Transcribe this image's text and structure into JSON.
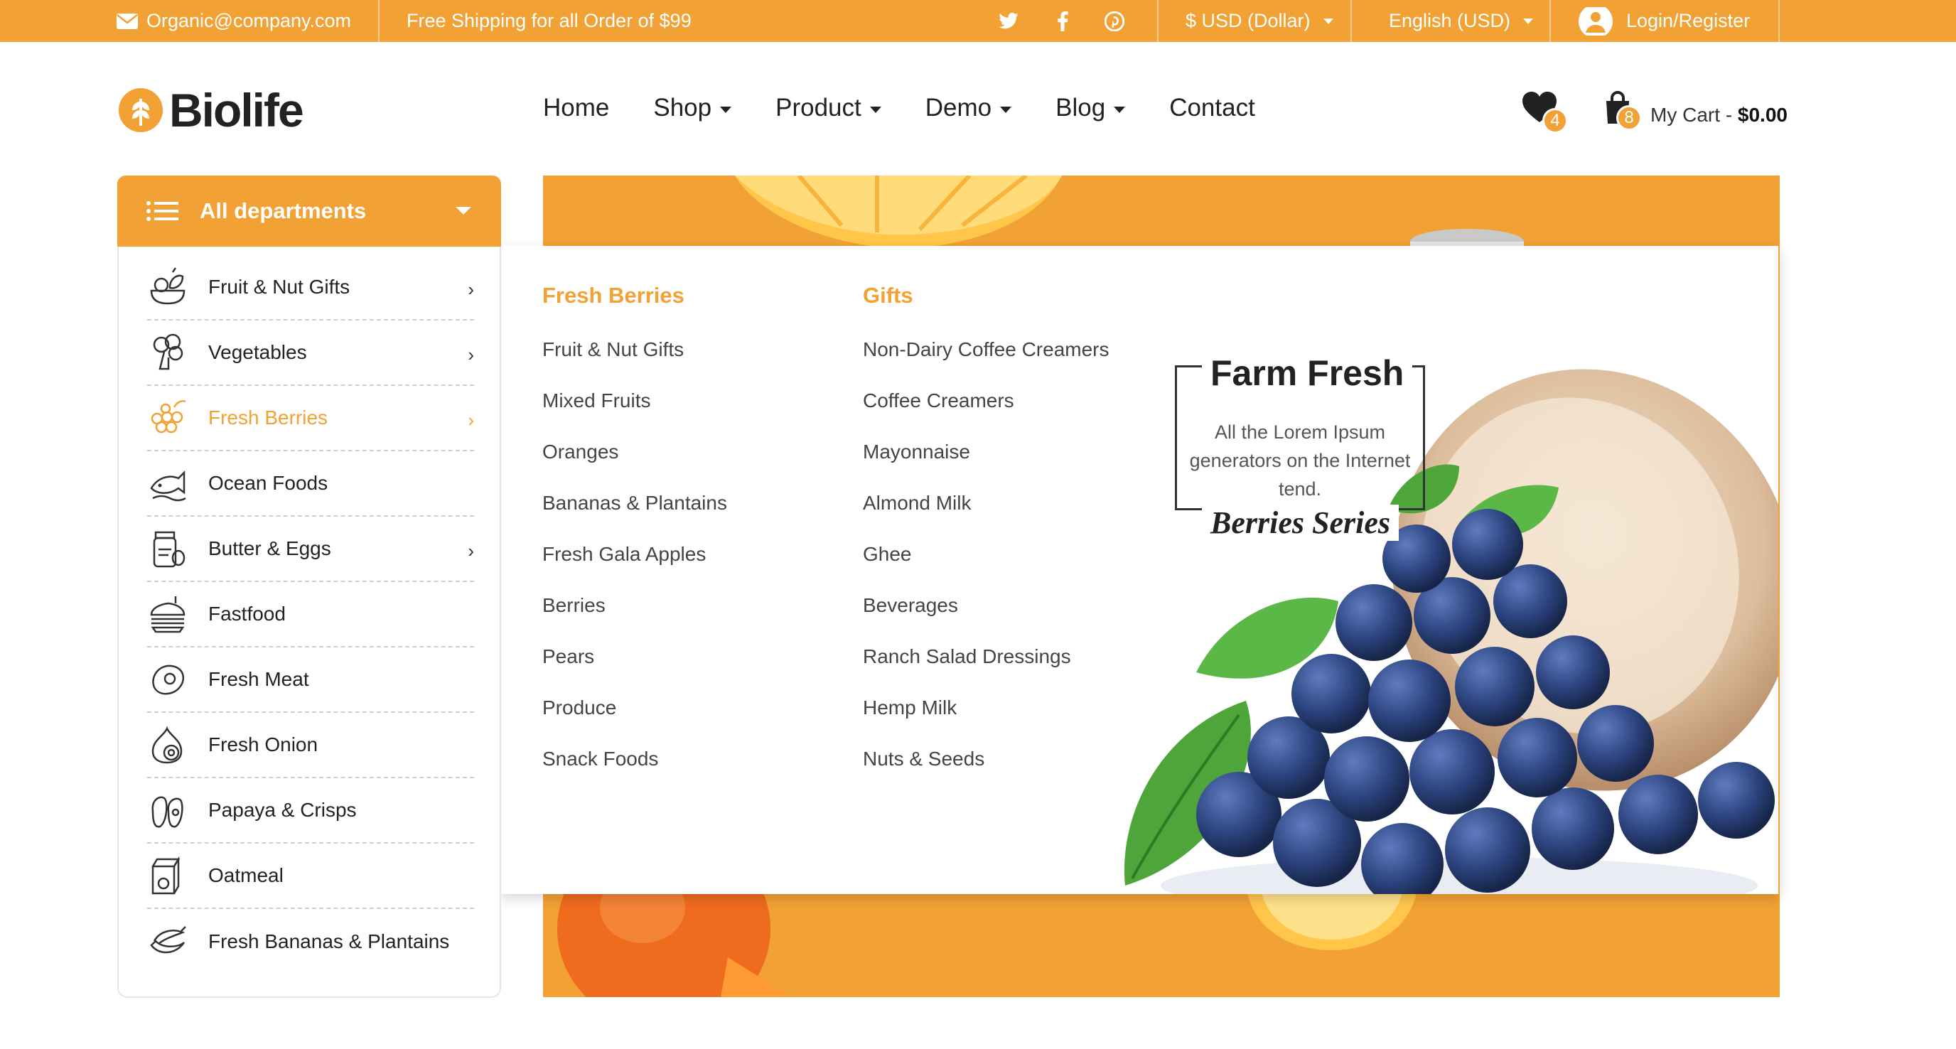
{
  "topbar": {
    "email": "Organic@company.com",
    "shipping": "Free Shipping for all Order of $99",
    "social_icons": [
      "twitter-icon",
      "facebook-icon",
      "pinterest-icon"
    ],
    "currency": "$ USD (Dollar)",
    "language": "English (USD)",
    "login": "Login/Register"
  },
  "brand": {
    "name": "Biolife",
    "accent": "#f2a134"
  },
  "nav": {
    "items": [
      {
        "label": "Home",
        "dropdown": false
      },
      {
        "label": "Shop",
        "dropdown": true
      },
      {
        "label": "Product",
        "dropdown": true
      },
      {
        "label": "Demo",
        "dropdown": true
      },
      {
        "label": "Blog",
        "dropdown": true
      },
      {
        "label": "Contact",
        "dropdown": false
      }
    ]
  },
  "wishlist": {
    "count": "4"
  },
  "cart": {
    "count": "8",
    "label": "My Cart - ",
    "total": "$0.00"
  },
  "departments": {
    "title": "All departments",
    "items": [
      {
        "label": "Fruit & Nut Gifts",
        "icon": "fruit-basket-icon",
        "has_submenu": true
      },
      {
        "label": "Vegetables",
        "icon": "broccoli-icon",
        "has_submenu": true
      },
      {
        "label": "Fresh Berries",
        "icon": "berries-icon",
        "has_submenu": true,
        "active": true
      },
      {
        "label": "Ocean Foods",
        "icon": "fish-icon",
        "has_submenu": false
      },
      {
        "label": "Butter & Eggs",
        "icon": "jar-icon",
        "has_submenu": true
      },
      {
        "label": "Fastfood",
        "icon": "burger-icon",
        "has_submenu": false
      },
      {
        "label": "Fresh Meat",
        "icon": "steak-icon",
        "has_submenu": false
      },
      {
        "label": "Fresh Onion",
        "icon": "onion-icon",
        "has_submenu": false
      },
      {
        "label": "Papaya & Crisps",
        "icon": "papaya-icon",
        "has_submenu": false
      },
      {
        "label": "Oatmeal",
        "icon": "oatmeal-box-icon",
        "has_submenu": false
      },
      {
        "label": "Fresh Bananas & Plantains",
        "icon": "banana-icon",
        "has_submenu": false
      }
    ]
  },
  "megamenu": {
    "columns": [
      {
        "heading": "Fresh Berries",
        "links": [
          "Fruit & Nut Gifts",
          "Mixed Fruits",
          "Oranges",
          "Bananas & Plantains",
          "Fresh Gala Apples",
          "Berries",
          "Pears",
          "Produce",
          "Snack Foods"
        ]
      },
      {
        "heading": "Gifts",
        "links": [
          "Non-Dairy Coffee Creamers",
          "Coffee Creamers",
          "Mayonnaise",
          "Almond Milk",
          "Ghee",
          "Beverages",
          "Ranch Salad Dressings",
          "Hemp Milk",
          "Nuts & Seeds"
        ]
      }
    ],
    "promo": {
      "title": "Farm Fresh",
      "text": "All the Lorem Ipsum generators on the Internet tend.",
      "series": "Berries Series"
    }
  }
}
